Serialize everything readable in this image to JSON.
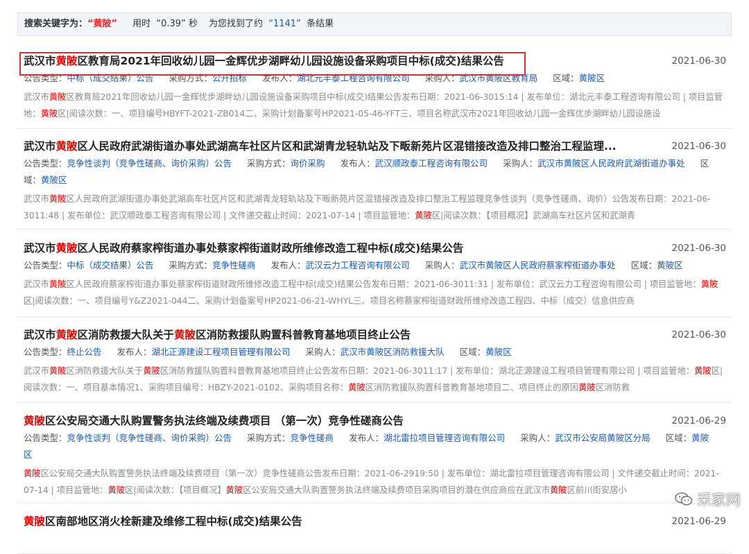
{
  "summary": {
    "label": "搜索关键字为：",
    "keyword": "“黄陂”",
    "time_pre": "用时",
    "time_val": "“0.39”",
    "time_unit": "秒",
    "count_pre": "为您找到了约",
    "count_val": "“1141”",
    "count_unit": "条结果"
  },
  "results": [
    {
      "title": [
        {
          "t": "武汉市"
        },
        {
          "t": "黄陂",
          "hl": true
        },
        {
          "t": "区教育局2021年回收幼儿园一金辉优步湖畔幼儿园设施设备采购项目中标(成交)结果公告"
        }
      ],
      "date": "2021-06-30",
      "meta": [
        {
          "label": "公告类型：",
          "value": "中标（成交结果）公告"
        },
        {
          "label": "采购方式：",
          "value": "公开招标"
        },
        {
          "label": "发布人：",
          "value": "湖北元丰泰工程咨询有限公司"
        },
        {
          "label": "采购人：",
          "value": "武汉市黄陂区教育局"
        },
        {
          "label": "区域：",
          "value": "黄陂区"
        }
      ],
      "snippet": [
        {
          "t": "武汉市"
        },
        {
          "t": "黄陂",
          "hl": true
        },
        {
          "t": "区教育局2021年回收幼儿园一金辉优步湖畔幼儿园设施设备采购项目中标(成交)结果公告发布日期：2021-06-3015:14 | 发布单位：湖北元丰泰工程咨询有限公司 | 项目监管地："
        },
        {
          "t": "黄陂",
          "hl": true
        },
        {
          "t": "区|阅读次数：一、项目编号HBYFT-2021-ZB014二、采购计划备案号HP2021-05-46-YFT三、项目名称武汉市2021年回收幼儿园一金辉优步湖畔幼儿园设施设"
        }
      ]
    },
    {
      "title": [
        {
          "t": "武汉市"
        },
        {
          "t": "黄陂",
          "hl": true
        },
        {
          "t": "区人民政府武湖街道办事处武湖高车社区片区和武湖青龙轻轨站及下畈新苑片区混错接改造及排口整治工程监理..."
        }
      ],
      "date": "2021-06-30",
      "meta": [
        {
          "label": "公告类型：",
          "value": "竞争性谈判（竞争性磋商、询价采购）公告"
        },
        {
          "label": "采购方式：",
          "value": "询价采购"
        },
        {
          "label": "发布人：",
          "value": "武汉顺政泰工程咨询有限公司"
        },
        {
          "label": "采购人：",
          "value": "武汉市黄陂区人民政府武湖街道办事处"
        },
        {
          "label": "区域：",
          "value": "黄陂区"
        }
      ],
      "snippet": [
        {
          "t": "武汉市"
        },
        {
          "t": "黄陂",
          "hl": true
        },
        {
          "t": "区人民政府武湖街道办事处武湖高车社区片区和武湖青龙轻轨站及下畈新苑片区混错接改造及排口整治工程监理竞争性谈判（竞争性磋商、询价）公告发布日期：2021-06-3011:48 | 发布单位：武汉顺政泰工程咨询有限公司 | 文件递交截止时间：2021-07-14 | 项目监管地："
        },
        {
          "t": "黄陂",
          "hl": true
        },
        {
          "t": "区|阅读次数：【项目概况】武湖高车社区片区和武湖青"
        }
      ]
    },
    {
      "title": [
        {
          "t": "武汉市"
        },
        {
          "t": "黄陂",
          "hl": true
        },
        {
          "t": "区人民政府蔡家榨街道办事处蔡家榨街道财政所维修改造工程中标(成交)结果公告"
        }
      ],
      "date": "2021-06-30",
      "meta": [
        {
          "label": "公告类型：",
          "value": "中标（成交结果）公告"
        },
        {
          "label": "采购方式：",
          "value": "竞争性磋商"
        },
        {
          "label": "发布人：",
          "value": "武汉云力工程咨询有限公司"
        },
        {
          "label": "采购人：",
          "value": "武汉市黄陂区人民政府蔡家榨街道办事处"
        },
        {
          "label": "区域：",
          "value": "黄陂区"
        }
      ],
      "snippet": [
        {
          "t": "武汉市"
        },
        {
          "t": "黄陂",
          "hl": true
        },
        {
          "t": "区人民政府蔡家榨街道办事处蔡家榨街道财政所维修改造工程中标(成交)结果公告发布日期：2021-06-3011:31 | 发布单位：武汉云力工程咨询有限公司 | 项目监管地："
        },
        {
          "t": "黄陂",
          "hl": true
        },
        {
          "t": "区|阅读次数：一、项目编号Y&Z2021-044二、采购计划备案号HP2021-06-21-WHYL三、项目名称蔡家榨街道财政所维修改造工程四、中标（成交）信息供应商"
        }
      ]
    },
    {
      "title": [
        {
          "t": "武汉市"
        },
        {
          "t": "黄陂",
          "hl": true
        },
        {
          "t": "区消防救援大队关于"
        },
        {
          "t": "黄陂",
          "hl": true
        },
        {
          "t": "区消防救援队购置科普教育基地项目终止公告"
        }
      ],
      "date": "2021-06-30",
      "meta": [
        {
          "label": "公告类型：",
          "value": "终止公告"
        },
        {
          "label": "发布人：",
          "value": "湖北正源建设工程项目管理有限公司"
        },
        {
          "label": "采购人：",
          "value": "武汉市黄陂区消防救援大队"
        },
        {
          "label": "区域：",
          "value": "黄陂区"
        }
      ],
      "snippet": [
        {
          "t": "武汉市"
        },
        {
          "t": "黄陂",
          "hl": true
        },
        {
          "t": "区消防救援大队关于"
        },
        {
          "t": "黄陂",
          "hl": true
        },
        {
          "t": "区消防救援队购置科普教育基地项目终止公告发布日期：2021-06-3011:17 | 发布单位：湖北正源建设工程项目管理有限公司 | 项目监管地："
        },
        {
          "t": "黄陂",
          "hl": true
        },
        {
          "t": "区|阅读次数：一、项目基本情况1、采购项目编号：HBZY-2021-0102、采购项目名称："
        },
        {
          "t": "黄陂",
          "hl": true
        },
        {
          "t": "区消防救援队购置科普教育基地项目二、项目终止的原因"
        },
        {
          "t": "黄陂",
          "hl": true
        },
        {
          "t": "区消防救"
        }
      ]
    },
    {
      "title": [
        {
          "t": "黄陂",
          "hl": true
        },
        {
          "t": "区公安局交通大队购置警务执法终端及续费项目 （第一次）竞争性磋商公告"
        }
      ],
      "date": "2021-06-29",
      "meta": [
        {
          "label": "公告类型：",
          "value": "竞争性谈判（竞争性磋商、询价采购）公告"
        },
        {
          "label": "采购方式：",
          "value": "竞争性磋商"
        },
        {
          "label": "发布人：",
          "value": "湖北雷拉项目管理咨询有限公司"
        },
        {
          "label": "采购人：",
          "value": "武汉市公安局黄陂区分局"
        },
        {
          "label": "区域：",
          "value": "黄陂区"
        }
      ],
      "snippet": [
        {
          "t": "黄陂",
          "hl": true
        },
        {
          "t": "区公安局交通大队购置警务执法终端及续费项目（第一次）竞争性磋商公告发布日期：2021-06-2919:50 | 发布单位：湖北雷拉项目管理咨询有限公司 | 文件递交截止时间：2021-07-14 | 项目监管地："
        },
        {
          "t": "黄陂",
          "hl": true
        },
        {
          "t": "区|阅读次数：【项目概况】"
        },
        {
          "t": "黄陂",
          "hl": true
        },
        {
          "t": "区公安局交通大队购置警务执法终端及续费项目采购项目的潜在供应商应在武汉市"
        },
        {
          "t": "黄陂",
          "hl": true
        },
        {
          "t": "区前川街安居小"
        }
      ]
    },
    {
      "title": [
        {
          "t": "黄陂",
          "hl": true
        },
        {
          "t": "区南部地区消火栓新建及维修工程中标(成交)结果公告"
        }
      ],
      "date": "2021-06-29",
      "meta": [],
      "snippet": []
    }
  ],
  "watermark": {
    "text": "采家网",
    "icon": "wechat-icon"
  },
  "colors": {
    "highlight": "#e00000",
    "link": "#1c5aa8",
    "box": "#d9312f"
  }
}
